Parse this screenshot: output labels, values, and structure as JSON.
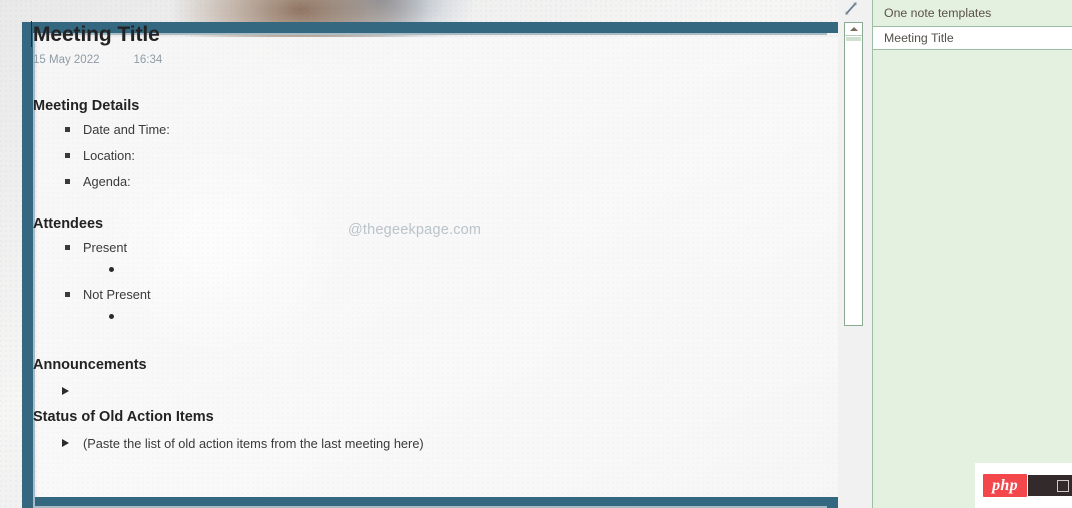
{
  "note": {
    "title": "Meeting Title",
    "date": "15 May 2022",
    "time": "16:34",
    "watermark": "@thegeekpage.com",
    "sections": {
      "details": {
        "heading": "Meeting Details",
        "items": [
          "Date and Time:",
          "Location:",
          "Agenda:"
        ]
      },
      "attendees": {
        "heading": "Attendees",
        "present_label": "Present",
        "not_present_label": "Not Present",
        "present_sub": "",
        "not_present_sub": ""
      },
      "announcements": {
        "heading": "Announcements",
        "item": ""
      },
      "status": {
        "heading": "Status of Old Action Items",
        "item": "(Paste the list of old action items from the last meeting here)"
      }
    }
  },
  "sidebar": {
    "section_header": "One note templates",
    "page_item": "Meeting Title",
    "resize_icon": "diagonal-resize-icon",
    "scroll_up_icon": "scroll-up-arrow-icon"
  },
  "watermark_badge": {
    "logo_text": "php",
    "wordmark": ""
  },
  "colors": {
    "frame_teal": "#336880",
    "frame_inner": "#a9bcc6",
    "sidebar_green": "#e4f0e0",
    "sidebar_border": "#9cbfa4",
    "php_red": "#f3474b",
    "stamp_gray": "#8e9ba6"
  }
}
